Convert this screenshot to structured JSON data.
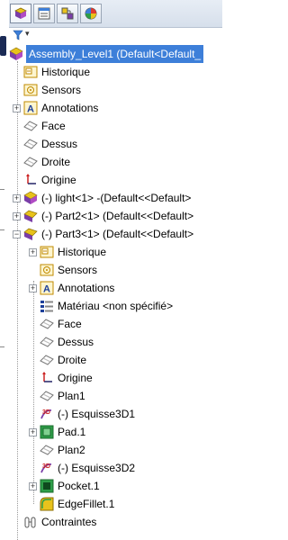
{
  "tabs": [
    {
      "name": "featuremanager-tab-icon",
      "active": true
    },
    {
      "name": "propertymanager-tab-icon",
      "active": false
    },
    {
      "name": "configurationmanager-tab-icon",
      "active": false
    },
    {
      "name": "displaymanager-tab-icon",
      "active": false
    }
  ],
  "filter": {
    "icon": "filter-icon"
  },
  "tree": {
    "root": "Assembly_Level1  (Default<Default_",
    "items": [
      "Historique",
      "Sensors",
      "Annotations",
      "Face",
      "Dessus",
      "Droite",
      "Origine",
      "(-) light<1> -(Default<<Default>",
      "(-) Part2<1> (Default<<Default>",
      "(-) Part3<1> (Default<<Default>",
      "Historique",
      "Sensors",
      "Annotations",
      "Matériau <non spécifié>",
      "Face",
      "Dessus",
      "Droite",
      "Origine",
      "Plan1",
      "(-) Esquisse3D1",
      "Pad.1",
      "Plan2",
      "(-) Esquisse3D2",
      "Pocket.1",
      "EdgeFillet.1",
      "Contraintes"
    ]
  },
  "colors": {
    "selection": "#3d7fd9",
    "tab_bg": "#dde5ef",
    "part_yellow": "#e8c21c",
    "part_purple": "#7a3ea8"
  }
}
